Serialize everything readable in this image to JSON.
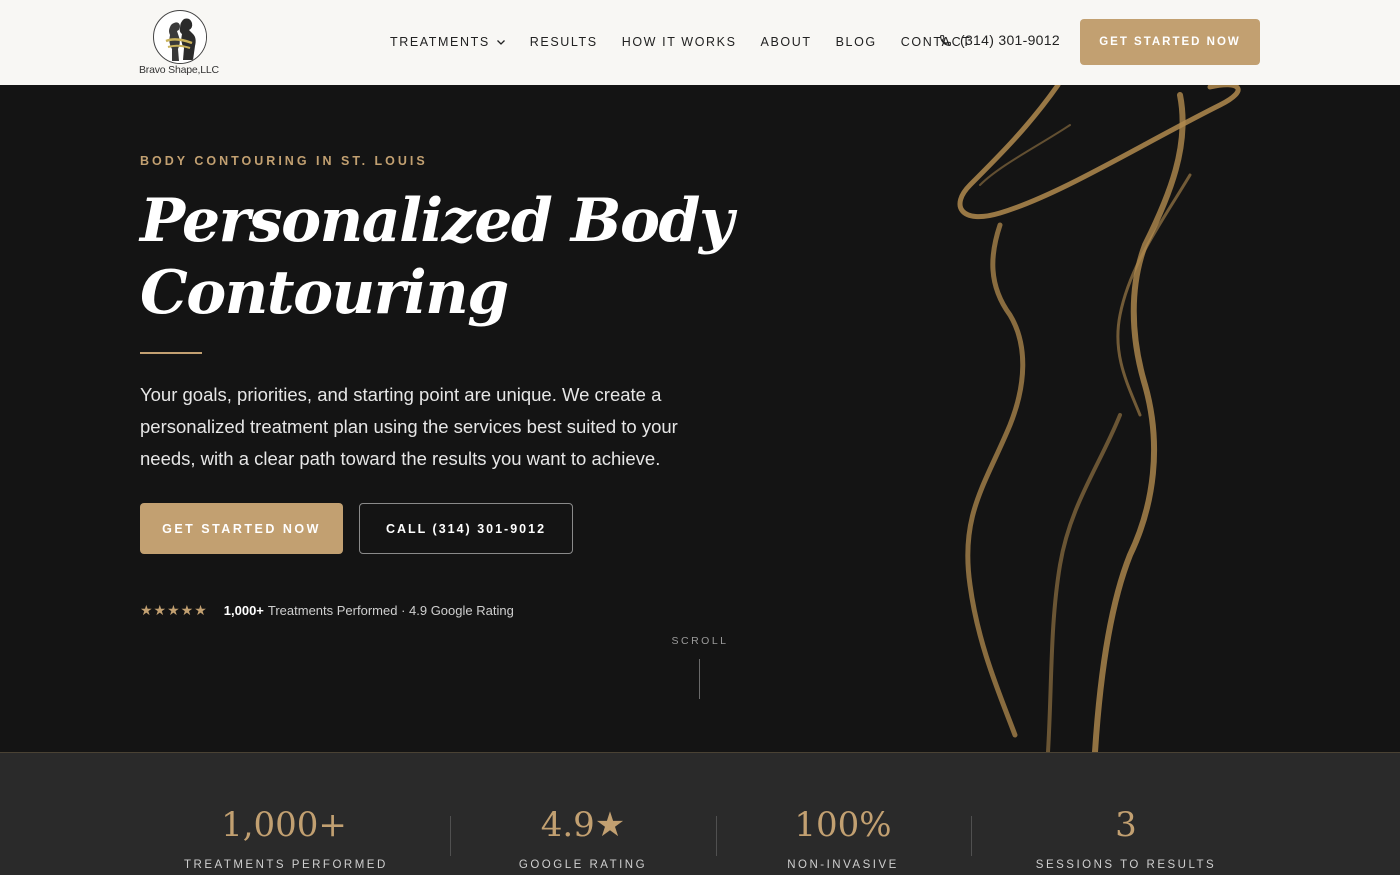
{
  "brand": {
    "logo_text": "Bravo Shape,LLC"
  },
  "nav": {
    "items": [
      {
        "label": "TREATMENTS",
        "has_dropdown": true
      },
      {
        "label": "RESULTS"
      },
      {
        "label": "HOW IT WORKS"
      },
      {
        "label": "ABOUT"
      },
      {
        "label": "BLOG"
      },
      {
        "label": "CONTACT"
      }
    ],
    "phone": "(314) 301-9012",
    "cta": "GET STARTED NOW"
  },
  "hero": {
    "eyebrow": "BODY CONTOURING IN ST. LOUIS",
    "title_line1": "Personalized Body",
    "title_line2": "Contouring",
    "lead": "Your goals, priorities, and starting point are unique. We create a personalized treatment plan using the services best suited to your needs, with a clear path toward the results you want to achieve.",
    "primary_cta": "GET STARTED NOW",
    "secondary_cta": "CALL (314) 301-9012",
    "stars": "★★★★★",
    "rating_strong": "1,000+",
    "rating_text": "Treatments Performed · 4.9 Google Rating",
    "scroll_label": "SCROLL"
  },
  "stats": [
    {
      "value": "1,000+",
      "label": "TREATMENTS PERFORMED"
    },
    {
      "value": "4.9★",
      "label": "GOOGLE RATING"
    },
    {
      "value": "100%",
      "label": "NON-INVASIVE"
    },
    {
      "value": "3",
      "label": "SESSIONS TO RESULTS"
    }
  ],
  "colors": {
    "accent": "#c2a071",
    "dark": "#141414",
    "stats_bg": "#2a2a2a",
    "header_bg": "#f8f7f4"
  }
}
